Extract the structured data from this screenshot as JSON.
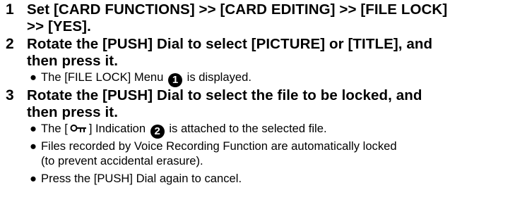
{
  "steps": [
    {
      "number": "1",
      "line1": "Set [CARD FUNCTIONS] >> [CARD EDITING] >> [FILE LOCK]",
      "line2": ">> [YES]."
    },
    {
      "number": "2",
      "line1": "Rotate the [PUSH] Dial to select [PICTURE] or [TITLE], and",
      "line2": "then press it.",
      "note": {
        "before": "The [FILE LOCK] Menu",
        "marker": "1",
        "after": "is displayed."
      }
    },
    {
      "number": "3",
      "line1": "Rotate the [PUSH] Dial to select the file to be locked, and",
      "line2": "then press it.",
      "notes": [
        {
          "before": "The [",
          "icon": "key-lock-icon",
          "middle": "] Indication",
          "marker": "2",
          "after": "is attached to the selected file."
        },
        {
          "line1": "Files recorded by Voice Recording Function are automatically locked",
          "line2": "(to prevent accidental erasure)."
        },
        {
          "text": "Press the [PUSH] Dial again to cancel."
        }
      ]
    }
  ],
  "bullet": "●"
}
